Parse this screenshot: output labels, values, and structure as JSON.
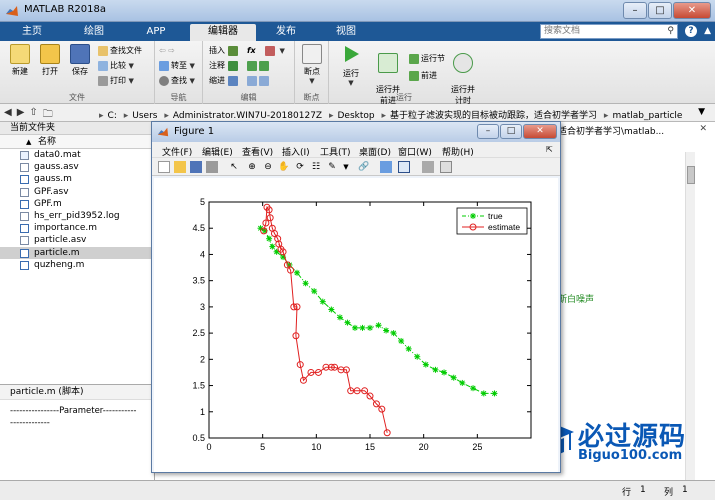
{
  "app": {
    "title": "MATLAB R2018a",
    "window_buttons": [
      "–",
      "□",
      "✕"
    ]
  },
  "ribbon": {
    "tabs": [
      {
        "label": "主页",
        "active": false
      },
      {
        "label": "绘图",
        "active": false
      },
      {
        "label": "APP",
        "active": false
      },
      {
        "label": "编辑器",
        "active": true
      },
      {
        "label": "发布",
        "active": false
      },
      {
        "label": "视图",
        "active": false
      }
    ],
    "search_placeholder": "搜索文档",
    "help": "?",
    "groups": {
      "file": {
        "label": "文件",
        "new": "新建",
        "open": "打开",
        "save": "保存",
        "find_files": "查找文件",
        "compare": "比较",
        "print": "打印"
      },
      "navigate": {
        "label": "导航",
        "goto": "转至",
        "find": "查找"
      },
      "edit": {
        "label": "编辑",
        "insert": "插入",
        "fx": "fx",
        "comment": "注释",
        "indent": "缩进"
      },
      "breakpoints": {
        "label": "断点",
        "breakpoints": "断点"
      },
      "run": {
        "label": "运行",
        "run": "运行",
        "run_advance": "运行并\n前进",
        "run_section": "运行节",
        "advance": "前进",
        "run_time": "运行并\n计时"
      }
    }
  },
  "address_bar": {
    "segments": [
      "C:",
      "Users",
      "Administrator.WIN7U-20180127Z",
      "Desktop",
      "基于粒子滤波实现的目标被动跟踪，适合初学者学习",
      "matlab_particle"
    ]
  },
  "folder_panel": {
    "title": "当前文件夹",
    "column_header": "名称",
    "files": [
      {
        "name": "data0.mat",
        "type": "mat",
        "selected": false
      },
      {
        "name": "gauss.asv",
        "type": "asv",
        "selected": false
      },
      {
        "name": "gauss.m",
        "type": "m",
        "selected": false
      },
      {
        "name": "GPF.asv",
        "type": "asv",
        "selected": false
      },
      {
        "name": "GPF.m",
        "type": "m",
        "selected": false
      },
      {
        "name": "hs_err_pid3952.log",
        "type": "log",
        "selected": false
      },
      {
        "name": "importance.m",
        "type": "m",
        "selected": false
      },
      {
        "name": "particle.asv",
        "type": "asv",
        "selected": false
      },
      {
        "name": "particle.m",
        "type": "m",
        "selected": true
      },
      {
        "name": "quzheng.m",
        "type": "m",
        "selected": false
      }
    ]
  },
  "details_panel": {
    "title": "particle.m  (脚本)",
    "lines": [
      "----------------Parameter-----------",
      "-------------"
    ]
  },
  "editor": {
    "tab_fragment": "踪，适合初学者学习\\matlab...",
    "visible_text": "值高斯白噪声"
  },
  "status_bar": {
    "row_label": "行",
    "row_value": "1",
    "col_label": "列",
    "col_value": "1"
  },
  "figure": {
    "title": "Figure 1",
    "menus": [
      "文件(F)",
      "编辑(E)",
      "查看(V)",
      "插入(I)",
      "工具(T)",
      "桌面(D)",
      "窗口(W)",
      "帮助(H)"
    ],
    "chart_data": {
      "type": "line",
      "title": "",
      "xlabel": "",
      "ylabel": "",
      "xlim": [
        0,
        30
      ],
      "ylim": [
        0.5,
        5
      ],
      "xticks": [
        0,
        5,
        10,
        15,
        20,
        25
      ],
      "yticks": [
        0.5,
        1,
        1.5,
        2,
        2.5,
        3,
        3.5,
        4,
        4.5,
        5
      ],
      "legend_position": "top-right",
      "series": [
        {
          "name": "true",
          "color": "#00cc00",
          "marker": "*",
          "line": "dashdot",
          "x": [
            4.8,
            5.2,
            5.6,
            5.9,
            6.3,
            6.9,
            7.5,
            8.2,
            9.0,
            9.8,
            10.6,
            11.4,
            12.2,
            12.9,
            13.6,
            14.3,
            15.0,
            15.8,
            16.5,
            17.2,
            17.9,
            18.6,
            19.4,
            20.2,
            21.1,
            21.9,
            22.8,
            23.6,
            24.6,
            25.6,
            26.6
          ],
          "y": [
            4.5,
            4.45,
            4.3,
            4.15,
            4.05,
            3.95,
            3.8,
            3.65,
            3.45,
            3.3,
            3.1,
            2.95,
            2.8,
            2.7,
            2.6,
            2.6,
            2.6,
            2.65,
            2.55,
            2.5,
            2.35,
            2.2,
            2.05,
            1.9,
            1.8,
            1.75,
            1.65,
            1.55,
            1.45,
            1.35,
            1.35
          ]
        },
        {
          "name": "estimate",
          "color": "#e02020",
          "marker": "o",
          "line": "solid",
          "x": [
            5.1,
            5.3,
            5.4,
            5.6,
            5.7,
            5.9,
            6.1,
            6.4,
            6.7,
            6.5,
            6.9,
            7.3,
            7.6,
            7.9,
            8.2,
            8.1,
            8.5,
            8.8,
            9.5,
            10.2,
            10.9,
            11.4,
            11.7,
            12.3,
            12.8,
            13.2,
            13.8,
            14.5,
            15.0,
            15.6,
            16.1,
            16.6
          ],
          "y": [
            4.45,
            4.6,
            4.9,
            4.85,
            4.7,
            4.5,
            4.4,
            4.3,
            4.1,
            4.2,
            4.05,
            3.8,
            3.7,
            3.0,
            3.0,
            2.45,
            1.9,
            1.6,
            1.75,
            1.75,
            1.85,
            1.85,
            1.85,
            1.8,
            1.8,
            1.4,
            1.4,
            1.4,
            1.3,
            1.15,
            1.05,
            0.6
          ]
        }
      ]
    }
  },
  "watermark": {
    "title": "必过源码",
    "subtitle": "Biguo100.com"
  }
}
